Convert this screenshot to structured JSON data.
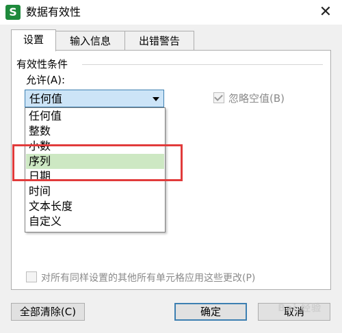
{
  "window": {
    "app_icon_glyph": "S",
    "title": "数据有效性",
    "close_glyph": "✕"
  },
  "tabs": [
    {
      "label": "设置",
      "active": true
    },
    {
      "label": "输入信息",
      "active": false
    },
    {
      "label": "出错警告",
      "active": false
    }
  ],
  "settings": {
    "group_title": "有效性条件",
    "allow_label": "允许(A):",
    "allow_value": "任何值",
    "ignore_blank_label": "忽略空值(B)",
    "ignore_blank_checked": true,
    "allow_options": [
      "任何值",
      "整数",
      "小数",
      "序列",
      "日期",
      "时间",
      "文本长度",
      "自定义"
    ],
    "selected_option": "序列",
    "apply_all_label": "对所有同样设置的其他所有单元格应用这些更改(P)"
  },
  "buttons": {
    "clear_all": "全部清除(C)",
    "ok": "确定",
    "cancel": "取消"
  },
  "watermark": "Bai 经验",
  "colors": {
    "highlight": "#e13b3b",
    "selected_row": "#cde8c3",
    "combo_fill": "#cce4f7",
    "app_icon": "#1e8a3c"
  }
}
